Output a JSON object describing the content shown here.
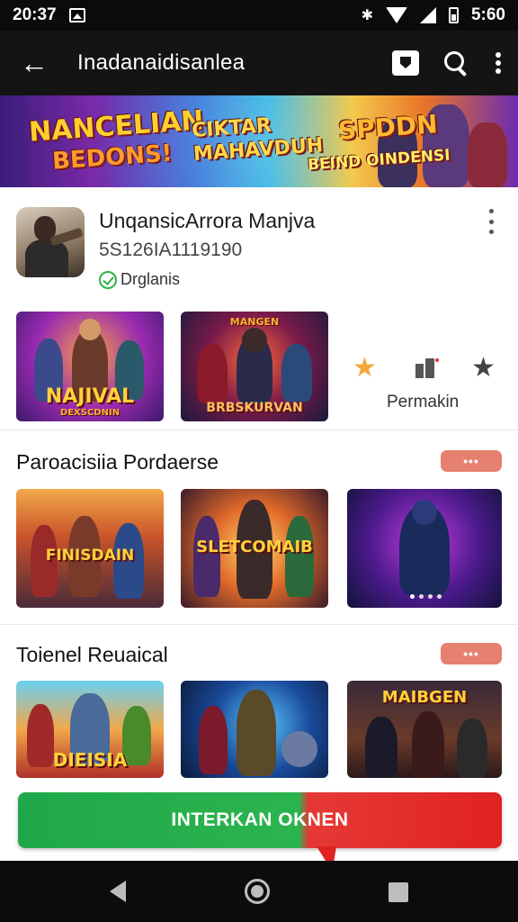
{
  "status_bar": {
    "time": "20:37",
    "clock": "5:60"
  },
  "app_bar": {
    "title": "Inadanaidisanlea"
  },
  "banner": {
    "text_1": "NANCELIAN",
    "text_1b": "BEDONS!",
    "text_2a": "CIKTAR",
    "text_2b": "MAHAVDUH",
    "text_3a": "SPDDN",
    "text_3b": "BEIND OINDENSI"
  },
  "app": {
    "name": "UnqansicArrora Manjva",
    "sub": "5S126IA1119190",
    "verified_label": "Drglanis",
    "stat_label": "Permakin",
    "screenshots": [
      {
        "label": "NAJIVAL",
        "sub": "DEXSCDNIN"
      },
      {
        "label": "BRBSKURVAN",
        "sub": "MANGEN"
      }
    ]
  },
  "sections": [
    {
      "title": "Paroacisiia Pordaerse",
      "pill": "•••",
      "cards": [
        {
          "label": "FINISDAIN"
        },
        {
          "label": "SLETCOMAIB"
        },
        {
          "label": ""
        }
      ]
    },
    {
      "title": "Toienel Reuaical",
      "pill": "•••",
      "cards": [
        {
          "label": "DIEISIA"
        },
        {
          "label": ""
        },
        {
          "label": "MAIBGEN"
        }
      ]
    }
  ],
  "install": {
    "label": "INTERKAN OKNEN"
  },
  "colors": {
    "install_green": "#2bb44e",
    "install_red": "#e02222",
    "pill": "#e6806f",
    "star_gold": "#f2a93a",
    "verified_green": "#2db34a"
  }
}
